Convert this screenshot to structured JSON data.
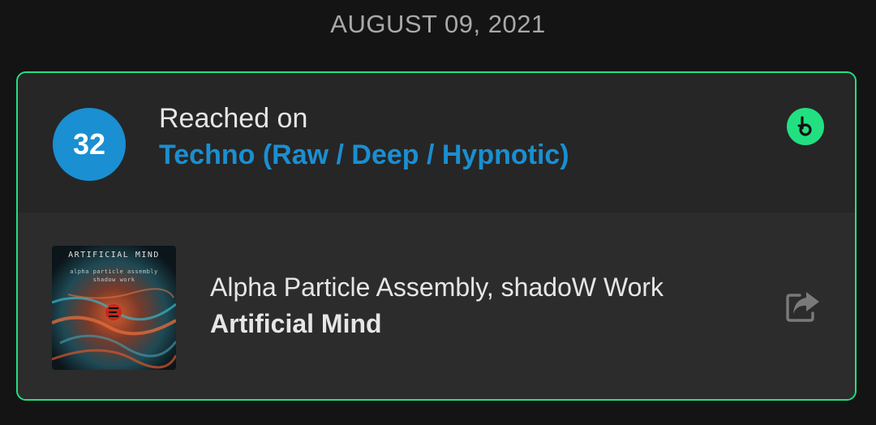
{
  "date_header": "AUGUST 09, 2021",
  "chart_entry": {
    "rank": "32",
    "reached_label": "Reached on",
    "chart_name": "Techno (Raw / Deep / Hypnotic)",
    "store_icon": "beatport-icon"
  },
  "track": {
    "artwork_title": "ARTIFICIAL MIND",
    "artwork_subtitle_1": "alpha particle assembly",
    "artwork_subtitle_2": "shadow work",
    "artists": "Alpha Particle Assembly, shadoW Work",
    "title": "Artificial Mind",
    "share_icon": "share-icon"
  },
  "colors": {
    "background": "#141414",
    "card_border": "#22e082",
    "rank_circle": "#1a8fd1",
    "chart_link": "#1a8fd1",
    "store_badge": "#22e082"
  }
}
